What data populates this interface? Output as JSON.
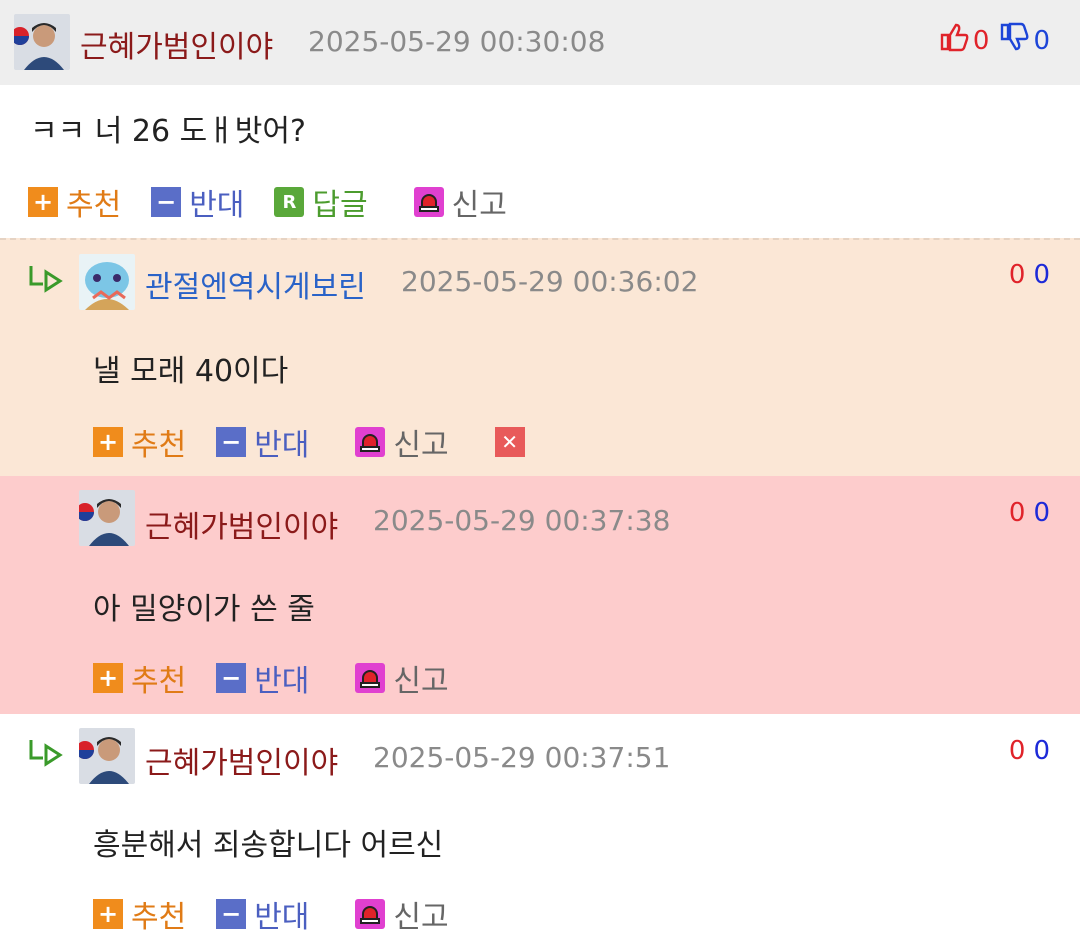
{
  "colors": {
    "accent_up": "#e0232a",
    "accent_down": "#1d45d8",
    "reply_bg_1": "#fbe7d6",
    "reply_bg_2": "#fdcccc"
  },
  "top_comment": {
    "nickname": "근혜가범인이야",
    "date": "2025-05-29 00:30:08",
    "upvotes": "0",
    "downvotes": "0",
    "text": "ㅋㅋ 너 26 도ㅐ밧어?",
    "actions": {
      "recommend": "추천",
      "oppose": "반대",
      "reply": "답글",
      "report": "신고"
    }
  },
  "replies": [
    {
      "nickname": "관절엔역시게보린",
      "date": "2025-05-29 00:36:02",
      "upvotes": "0",
      "downvotes": "0",
      "text": "낼 모래 40이다",
      "actions": {
        "recommend": "추천",
        "oppose": "반대",
        "report": "신고"
      }
    },
    {
      "nickname": "근혜가범인이야",
      "date": "2025-05-29 00:37:38",
      "upvotes": "0",
      "downvotes": "0",
      "text": "아 밀양이가 쓴 줄",
      "actions": {
        "recommend": "추천",
        "oppose": "반대",
        "report": "신고"
      }
    },
    {
      "nickname": "근혜가범인이야",
      "date": "2025-05-29 00:37:51",
      "upvotes": "0",
      "downvotes": "0",
      "text": "흥분해서 죄송합니다 어르신",
      "actions": {
        "recommend": "추천",
        "oppose": "반대",
        "report": "신고"
      }
    }
  ]
}
